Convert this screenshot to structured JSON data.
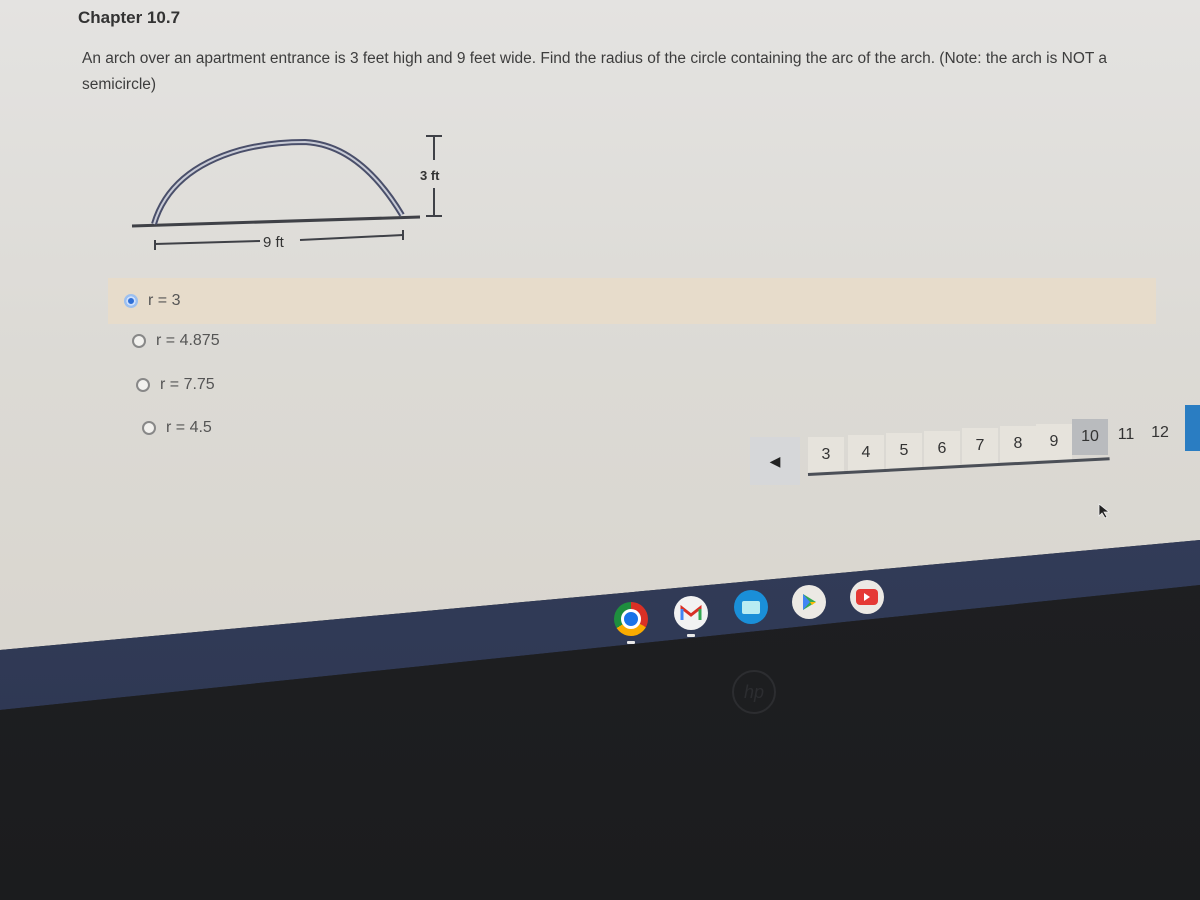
{
  "page": {
    "chapter_title": "Chapter 10.7",
    "question": "An arch over an apartment entrance is 3 feet high and 9 feet wide. Find the radius of the circle containing the arc of the arch. (Note: the arch is NOT a semicircle)"
  },
  "figure": {
    "height_label": "3 ft",
    "width_label": "9 ft",
    "arch_height_ft": 3,
    "arch_width_ft": 9
  },
  "options": [
    {
      "label": "r = 3",
      "selected": true
    },
    {
      "label": "r = 4.875",
      "selected": false
    },
    {
      "label": "r = 7.75",
      "selected": false
    },
    {
      "label": "r = 4.5",
      "selected": false
    }
  ],
  "pagination": {
    "prev_icon": "◀",
    "pages": [
      "3",
      "4",
      "5",
      "6",
      "7",
      "8",
      "9",
      "10",
      "11",
      "12"
    ],
    "current": "10"
  },
  "shelf": {
    "apps": [
      {
        "name": "chrome",
        "label": "Chrome"
      },
      {
        "name": "gmail",
        "label": "Gmail"
      },
      {
        "name": "files",
        "label": "Files"
      },
      {
        "name": "play-store",
        "label": "Play Store"
      },
      {
        "name": "youtube",
        "label": "YouTube"
      }
    ]
  },
  "bezel": {
    "logo": "hp"
  },
  "colors": {
    "selected_radio": "#2f6fd6",
    "selected_row_bg": "#e7dccb",
    "current_page_bg": "#b9bbbe",
    "next_button": "#2a7dc2"
  }
}
